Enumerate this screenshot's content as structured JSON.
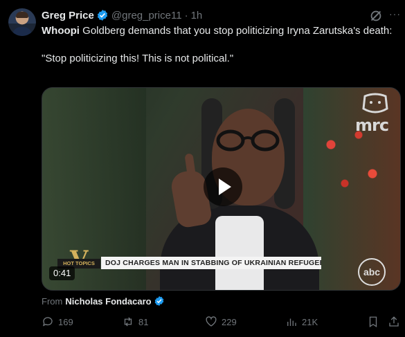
{
  "author": {
    "name": "Greg Price",
    "handle": "@greg_price11",
    "separator": "·",
    "time": "1h"
  },
  "tweet": {
    "bold_lead": "Whoopi",
    "line1_rest": " Goldberg demands that you stop politicizing Iryna Zarutska's death:",
    "quote": "\"Stop politicizing this! This is not political.\""
  },
  "media": {
    "duration": "0:41",
    "chyron": "DOJ CHARGES MAN IN STABBING OF UKRAINIAN REFUGEE",
    "hot_topics": "HOT TOPICS",
    "v_logo": "V",
    "mrc_logo": "mrc",
    "abc_logo": "abc"
  },
  "attribution": {
    "prefix": "From",
    "source": "Nicholas Fondacaro"
  },
  "actions": {
    "replies": "169",
    "reposts": "81",
    "likes": "229",
    "views": "21K"
  },
  "colors": {
    "background": "#000000",
    "verified_blue": "#1d9bf0",
    "muted": "#71767b",
    "text": "#e7e9ea"
  },
  "icons": [
    "verified-badge-icon",
    "grok-icon",
    "more-icon",
    "play-icon",
    "reply-icon",
    "repost-icon",
    "like-icon",
    "views-icon",
    "bookmark-icon",
    "share-icon"
  ]
}
